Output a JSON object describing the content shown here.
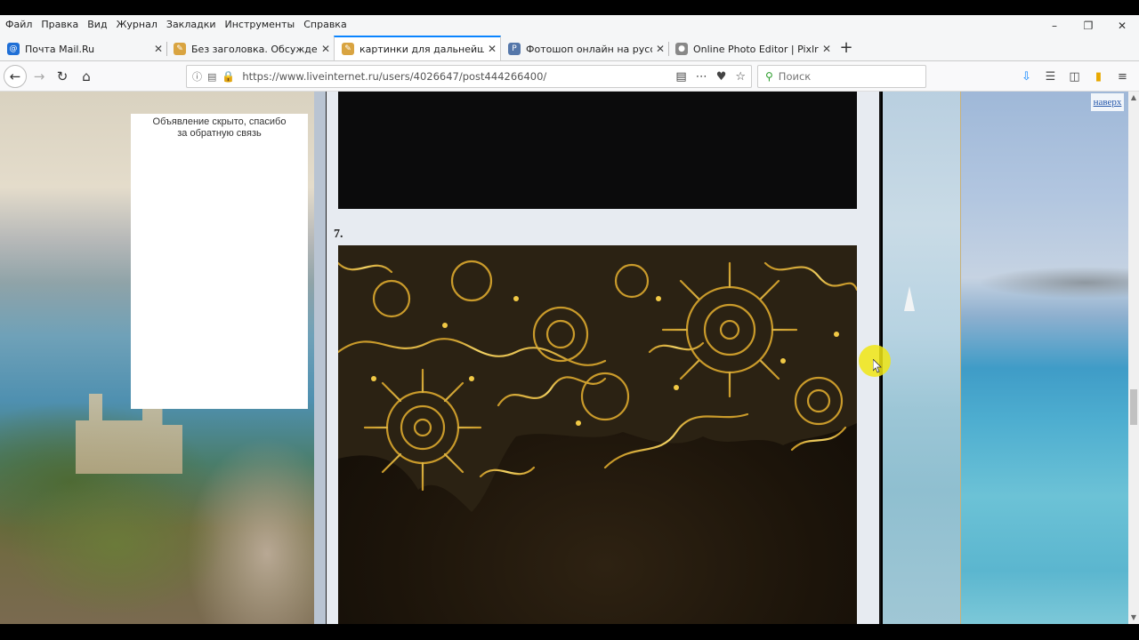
{
  "menu": [
    "Файл",
    "Правка",
    "Вид",
    "Журнал",
    "Закладки",
    "Инструменты",
    "Справка"
  ],
  "tabs": [
    {
      "label": "Почта Mail.Ru",
      "active": false
    },
    {
      "label": "Без заголовка. Обсуждение н",
      "active": false
    },
    {
      "label": "картинки для дальнейшего д",
      "active": true
    },
    {
      "label": "Фотошоп онлайн на русском",
      "active": false
    },
    {
      "label": "Online Photo Editor | Pixlr Edit",
      "active": false
    }
  ],
  "navbar": {
    "url": "https://www.liveinternet.ru/users/4026647/post444266400/",
    "search_placeholder": "Поиск"
  },
  "sidebar": {
    "ad_message": "Объявление скрыто, спасибо за обратную связь"
  },
  "post": {
    "item_number": "7."
  },
  "page": {
    "to_top": "наверх"
  },
  "colors": {
    "accent_tab": "#0a84ff",
    "lock": "#2aa52a",
    "link": "#2255aa",
    "cursor_highlight": "#f0e614",
    "lace_gold": "#e8c04a"
  }
}
